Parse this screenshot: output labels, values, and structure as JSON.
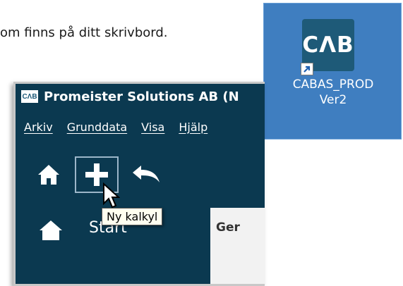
{
  "intro_text": "om finns på ditt skrivbord.",
  "desktop_shortcut": {
    "icon_text": "CΛB",
    "icon": "cabas-app-icon",
    "label_line1": "CABAS_PROD",
    "label_line2": "Ver2"
  },
  "window": {
    "logo_text": "CΛB",
    "title": "Promeister Solutions AB (N",
    "menu": [
      "Arkiv",
      "Grunddata",
      "Visa",
      "Hjälp"
    ],
    "toolbar": {
      "home_icon": "home-icon",
      "new_icon": "plus-icon",
      "back_icon": "back-arrow-icon"
    },
    "tooltip": "Ny kalkyl",
    "nav_start": "Start",
    "content_label": "Ger"
  },
  "colors": {
    "window_bg": "#0b3950",
    "desktop_selection": "#3f7ec0",
    "tooltip_bg": "#fffff0"
  }
}
